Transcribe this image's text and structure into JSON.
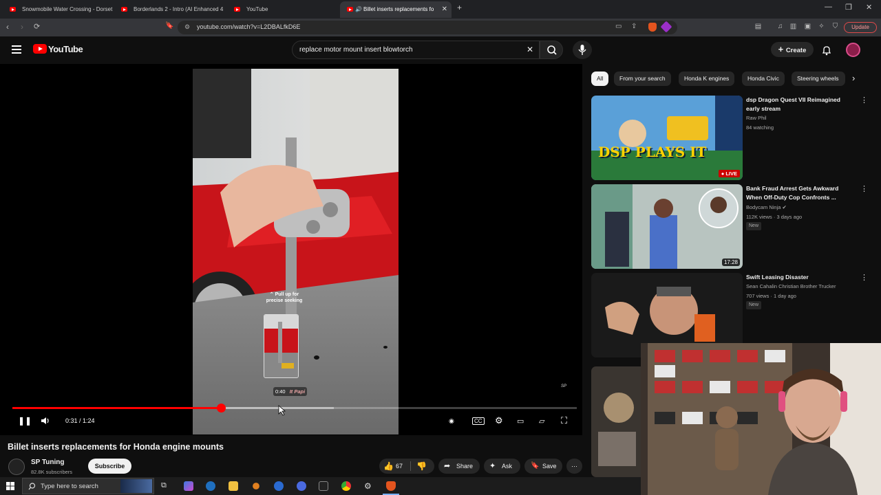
{
  "browser": {
    "tabs": [
      {
        "title": "Snowmobile Water Crossing - Dorset"
      },
      {
        "title": "Borderlands 2 - Intro (AI Enhanced 4"
      },
      {
        "title": "YouTube"
      },
      {
        "title": "Billet inserts replacements fo"
      }
    ],
    "url": "youtube.com/watch?v=L2DBALfkD6E",
    "update_label": "Update"
  },
  "header": {
    "logo": "YouTube",
    "search_value": "replace motor mount insert blowtorch",
    "create_label": "Create"
  },
  "player": {
    "time": "0:31 / 1:24",
    "progress": 0.37,
    "buffered": 0.57,
    "seek_hint": "Pull up for precise seeking",
    "seek_time": "0:40",
    "watermark": "It Papi"
  },
  "video": {
    "title": "Billet inserts replacements for Honda engine mounts",
    "channel": "SP Tuning",
    "subscribers": "82.8K subscribers",
    "subscribe_label": "Subscribe",
    "likes": "67",
    "share_label": "Share",
    "ask_label": "Ask",
    "save_label": "Save"
  },
  "chips": [
    "All",
    "From your search",
    "Honda K engines",
    "Honda Civic",
    "Steering wheels"
  ],
  "recommendations": [
    {
      "title": "dsp Dragon Quest VII Reimagined early stream",
      "channel": "Raw Phil",
      "meta": "84 watching",
      "badge": "LIVE",
      "thumb_text": "DSP PLAYS IT"
    },
    {
      "title": "Bank Fraud Arrest Gets Awkward When Off-Duty Cop Confronts ...",
      "channel": "Bodycam Ninja",
      "meta": "112K views · 3 days ago",
      "badge": "New",
      "duration": "17:28"
    },
    {
      "title": "Swift Leasing Disaster",
      "channel": "Sean Cahalin Christian Brother Trucker",
      "meta": "707 views · 1 day ago",
      "badge": "New"
    }
  ],
  "taskbar": {
    "search_placeholder": "Type here to search"
  },
  "colors": {
    "accent": "#ff0000",
    "background": "#0f0f0f",
    "chip_bg": "#272727"
  }
}
